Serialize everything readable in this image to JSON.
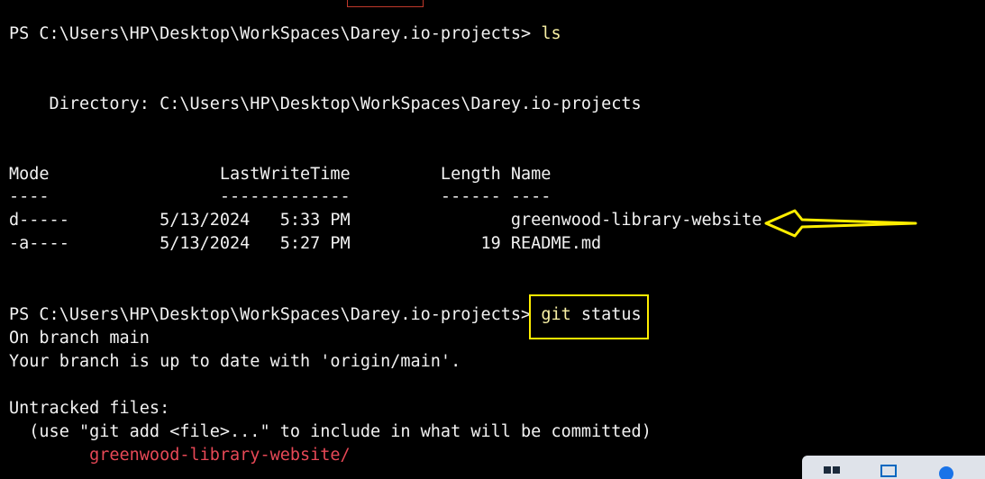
{
  "terminal": {
    "prompt1": "PS C:\\Users\\HP\\Desktop\\WorkSpaces\\Darey.io-projects> ",
    "cmd1": "ls",
    "directory_line": "    Directory: C:\\Users\\HP\\Desktop\\WorkSpaces\\Darey.io-projects",
    "header": "Mode                 LastWriteTime         Length Name",
    "separator": "----                 -------------         ------ ----",
    "rows": [
      "d-----         5/13/2024   5:33 PM                greenwood-library-website",
      "-a----         5/13/2024   5:27 PM             19 README.md"
    ],
    "prompt2": "PS C:\\Users\\HP\\Desktop\\WorkSpaces\\Darey.io-projects> ",
    "cmd2_word1": "git",
    "cmd2_word2": " status",
    "out1": "On branch main",
    "out2": "Your branch is up to date with 'origin/main'.",
    "out3": "Untracked files:",
    "out4": "  (use \"git add <file>...\" to include in what will be committed)",
    "untracked_file": "        greenwood-library-website/"
  },
  "colors": {
    "background": "#000000",
    "text": "#f2f2f2",
    "command": "#f9f1a5",
    "untracked": "#e74856",
    "annotation": "#ffee00"
  },
  "annotations": {
    "arrow_icon": "arrow-left-icon",
    "box": "highlight-box"
  }
}
